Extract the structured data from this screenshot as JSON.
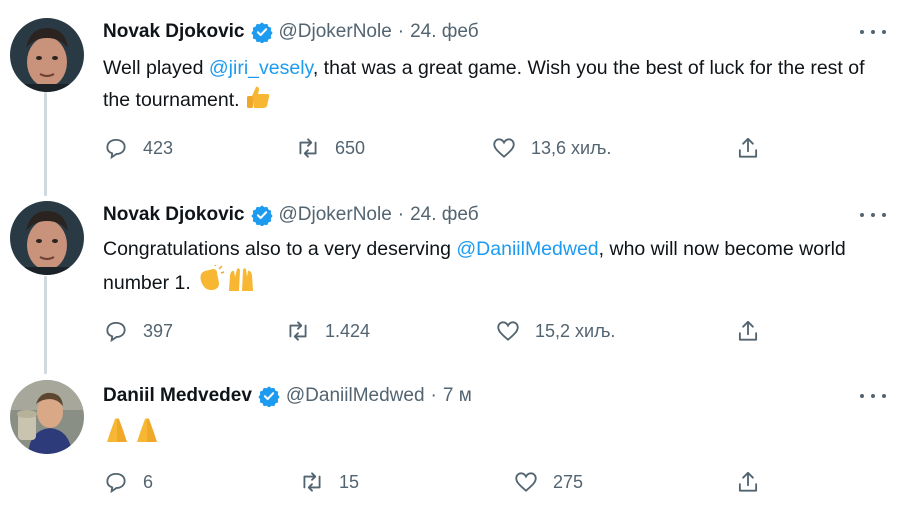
{
  "tweets": [
    {
      "author": "Novak Djokovic",
      "handle": "@DjokerNole",
      "separator": "·",
      "time": "24. феб",
      "text_before": "Well played ",
      "mention": "@jiri_vesely",
      "text_after": ", that was a great game. Wish you the best of luck for the rest of the tournament.",
      "emoji_icon": "thumbs-up-icon",
      "replies": "423",
      "retweets": "650",
      "likes": "13,6 хиљ."
    },
    {
      "author": "Novak Djokovic",
      "handle": "@DjokerNole",
      "separator": "·",
      "time": "24. феб",
      "text_before": "Congratulations also to a very deserving ",
      "mention": "@DaniilMedwed",
      "text_after": ", who will now become world number 1.",
      "emoji_icon": "clapping-hands-icon, raised-hands-icon",
      "replies": "397",
      "retweets": "1.424",
      "likes": "15,2 хиљ."
    },
    {
      "author": "Daniil Medvedev",
      "handle": "@DaniilMedwed",
      "separator": "·",
      "time": "7 м",
      "emoji_icon": "folded-hands-icon, folded-hands-icon",
      "replies": "6",
      "retweets": "15",
      "likes": "275"
    }
  ],
  "colors": {
    "text": "#0f1419",
    "secondary": "#536471",
    "accent": "#1d9bf0",
    "thread_line": "#cfd9de"
  }
}
